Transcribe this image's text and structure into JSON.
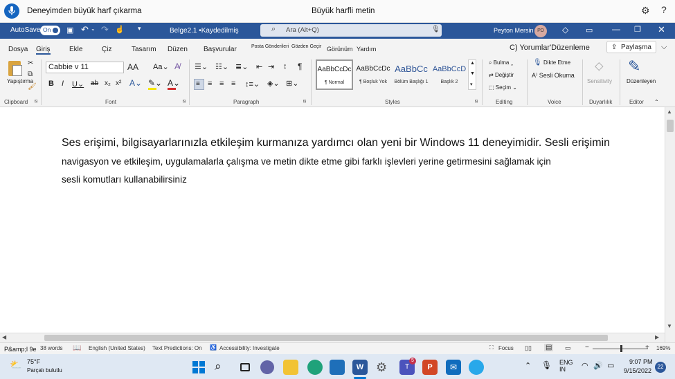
{
  "voice_bar": {
    "title": "Deneyimden büyük harf çıkarma",
    "center_text": "Büyük harfli metin",
    "icons": [
      "microphone-icon",
      "settings-icon",
      "help-icon"
    ]
  },
  "titlebar": {
    "autosave_label": "AutoSave",
    "autosave_state": "On",
    "doc_name": "Belge2.1 •Kaydedilmiş",
    "search_placeholder": "Ara (Alt+Q)",
    "user_name": "Peyton Mersin",
    "user_initials": "PD"
  },
  "tabs": {
    "items": [
      "Dosya",
      "Giriş",
      "Ekle",
      "Çiz",
      "Tasarım",
      "Düzen",
      "Başvurular",
      "Posta Gönderileri",
      "Gözden Geçir",
      "Görünüm",
      "Yardım"
    ],
    "active": "Giriş",
    "comments_label": "C) Yorumlar",
    "edit_label": "'Düzenleme",
    "share_label": "Paylaşma"
  },
  "ribbon": {
    "clipboard": {
      "paste_label": "Yapıştırma",
      "group_label": "Clipboard"
    },
    "font": {
      "font_name": "Cabbie v 11",
      "group_label": "Font"
    },
    "paragraph": {
      "group_label": "Paragraph"
    },
    "styles": {
      "group_label": "Styles",
      "items": [
        {
          "preview": "AaBbCcDc",
          "name": "¶ Normal"
        },
        {
          "preview": "AaBbCcDc",
          "name": "¶ Boşluk Yok"
        },
        {
          "preview": "AaBbCc",
          "name": "Bölüm Başlığı 1"
        },
        {
          "preview": "AaBbCcD",
          "name": "Başlık 2"
        }
      ]
    },
    "editing": {
      "find": "Bulma",
      "replace": "Değiştir",
      "select": "Seçim",
      "group_label": "Editing"
    },
    "voice": {
      "dictate": "Dikte Etme",
      "read_aloud": "Sesli Okuma",
      "group_label": "Voice"
    },
    "sensitivity": {
      "label": "Sensitivity",
      "group_label": "Duyarlılık"
    },
    "editor": {
      "label": "Düzenleyen",
      "group_label": "Editor"
    }
  },
  "document": {
    "line1": "Ses erişimi, bilgisayarlarınızla etkileşim kurmanıza yardımcı olan yeni bir Windows 11 deneyimidir. Sesli erişimin",
    "line2": "navigasyon ve etkileşim, uygulamalarla çalışma ve metin dikte etme gibi farklı işlevleri yerine getirmesini sağlamak için",
    "line3": "sesli komutları kullanabilirsiniz"
  },
  "statusbar": {
    "page": "P&amp;l 9e",
    "words": "38 words",
    "language": "English (United States)",
    "predictions": "Text Predictions: On",
    "accessibility": "Accessibility: Investigate",
    "focus": "Focus",
    "zoom": "169%"
  },
  "taskbar": {
    "weather_temp": "75°F",
    "weather_desc": "Parçalı bulutlu",
    "lang_top": "ENG",
    "lang_bottom": "IN",
    "time": "9:07 PM",
    "date": "9/15/2022",
    "notifications": "22",
    "teams_badge": "5"
  }
}
